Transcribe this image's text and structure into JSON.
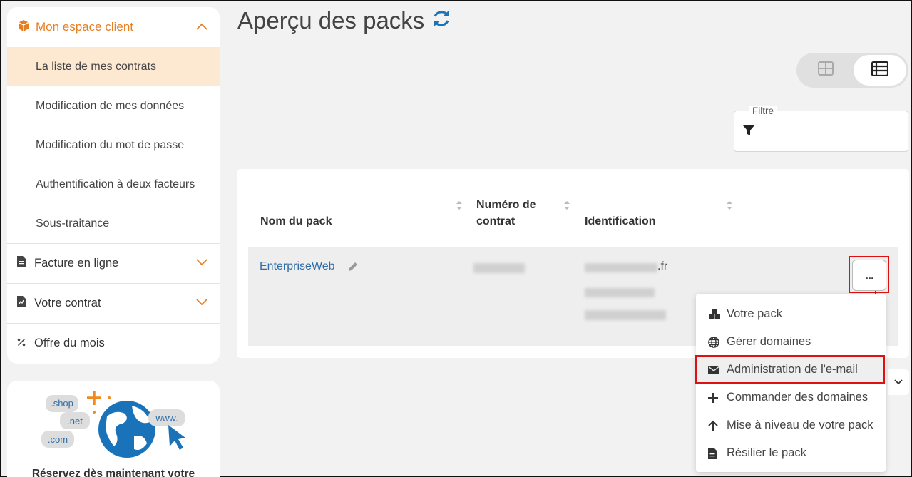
{
  "sidebar": {
    "header": "Mon espace client",
    "items": [
      {
        "label": "La liste de mes contrats",
        "active": true
      },
      {
        "label": "Modification de mes données"
      },
      {
        "label": "Modification du mot de passe"
      },
      {
        "label": "Authentification à deux facteurs"
      },
      {
        "label": "Sous-traitance"
      }
    ],
    "sections": [
      {
        "label": "Facture en ligne",
        "icon": "invoice-icon"
      },
      {
        "label": "Votre contrat",
        "icon": "contract-icon"
      },
      {
        "label": "Offre du mois",
        "icon": "percent-icon"
      }
    ]
  },
  "promo": {
    "bubbles": [
      ".shop",
      ".net",
      ".com",
      "www."
    ],
    "text": "Réservez dès maintenant votre"
  },
  "page": {
    "title": "Aperçu des packs",
    "filter_label": "Filtre"
  },
  "table": {
    "headers": [
      "Nom du pack",
      "Numéro de contrat",
      "Identification"
    ],
    "header_lines": [
      [
        "Nom du pack"
      ],
      [
        "Numéro de",
        "contrat"
      ],
      [
        "Identification"
      ]
    ],
    "row": {
      "pack_name": "EnterpriseWeb",
      "domain_suffix": ".fr",
      "more_label": "..."
    }
  },
  "menu": {
    "items": [
      {
        "label": "Votre pack",
        "icon": "cubes-icon"
      },
      {
        "label": "Gérer domaines",
        "icon": "globe-icon"
      },
      {
        "label": "Administration de l'e-mail",
        "icon": "envelope-icon",
        "highlighted": true
      },
      {
        "label": "Commander des domaines",
        "icon": "plus-icon"
      },
      {
        "label": "Mise à niveau de votre pack",
        "icon": "arrow-up-icon"
      },
      {
        "label": "Résilier le pack",
        "icon": "file-icon"
      }
    ]
  },
  "colors": {
    "accent_orange": "#e67e22",
    "active_bg": "#fde8d2",
    "link_blue": "#2f6ea8",
    "annotation_red": "#dd1111"
  }
}
